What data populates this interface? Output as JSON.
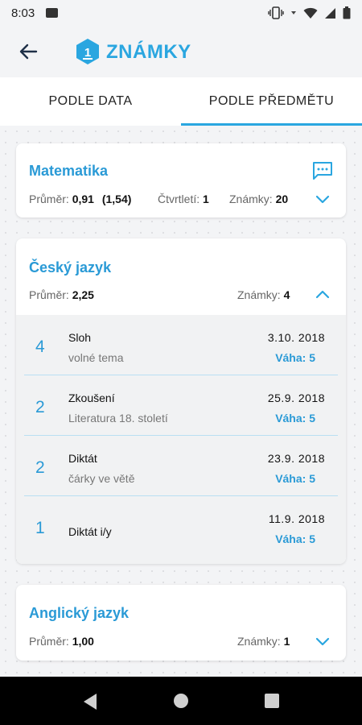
{
  "status": {
    "time": "8:03"
  },
  "header": {
    "title": "ZNÁMKY",
    "logo_number": "1"
  },
  "tabs": [
    {
      "label": "PODLE DATA"
    },
    {
      "label": "PODLE PŘEDMĚTU"
    }
  ],
  "subjects": [
    {
      "name": "Matematika",
      "average_label": "Průměr:",
      "average": "0,91",
      "average_extra": "(1,54)",
      "quarter_label": "Čtvrtletí:",
      "quarter": "1",
      "count_label": "Známky:",
      "count": "20"
    },
    {
      "name": "Český jazyk",
      "average_label": "Průměr:",
      "average": "2,25",
      "count_label": "Známky:",
      "count": "4",
      "grades": [
        {
          "value": "4",
          "name": "Sloh",
          "description": "volné tema",
          "date": "3.10. 2018",
          "weight": "Váha: 5"
        },
        {
          "value": "2",
          "name": "Zkoušení",
          "description": "Literatura 18. století",
          "date": "25.9. 2018",
          "weight": "Váha: 5"
        },
        {
          "value": "2",
          "name": "Diktát",
          "description": "čárky ve větě",
          "date": "23.9. 2018",
          "weight": "Váha: 5"
        },
        {
          "value": "1",
          "name": "Diktát i/y",
          "description": "",
          "date": "11.9. 2018",
          "weight": "Váha: 5"
        }
      ]
    },
    {
      "name": "Anglický jazyk",
      "average_label": "Průměr:",
      "average": "1,00",
      "count_label": "Známky:",
      "count": "1"
    }
  ],
  "colors": {
    "accent": "#2aa6e0",
    "title": "#2a9ad6",
    "separator": "#b9dff2"
  },
  "icons": [
    "image-icon",
    "vibrate-icon",
    "wifi-icon",
    "signal-icon",
    "battery-icon",
    "back-arrow-icon",
    "chat-icon",
    "chevron-down-icon",
    "chevron-up-icon",
    "nav-back-icon",
    "nav-home-icon",
    "nav-recents-icon"
  ]
}
